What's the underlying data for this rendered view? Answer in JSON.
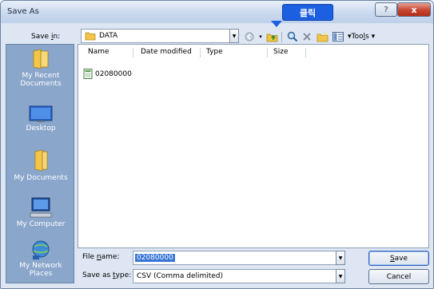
{
  "window": {
    "title": "Save As",
    "help_glyph": "?",
    "close_glyph": "x"
  },
  "callout": {
    "text": "클릭"
  },
  "toolbar": {
    "save_in_label_pre": "Save ",
    "save_in_label_key": "i",
    "save_in_label_post": "n:",
    "current_folder": "DATA",
    "tools_label_pre": "▾Too",
    "tools_label_key": "l",
    "tools_label_post": "s ▾"
  },
  "places": [
    {
      "label_line1": "My Recent",
      "label_line2": "Documents",
      "icon": "recent-docs-icon"
    },
    {
      "label_line1": "Desktop",
      "label_line2": "",
      "icon": "desktop-icon"
    },
    {
      "label_line1": "My Documents",
      "label_line2": "",
      "icon": "my-documents-icon"
    },
    {
      "label_line1": "My Computer",
      "label_line2": "",
      "icon": "my-computer-icon"
    },
    {
      "label_line1": "My Network",
      "label_line2": "Places",
      "icon": "network-places-icon"
    }
  ],
  "filelist": {
    "columns": [
      "Name",
      "Date modified",
      "Type",
      "Size"
    ],
    "files": [
      {
        "name": "02080000",
        "icon": "csv-file-icon"
      }
    ]
  },
  "form": {
    "file_name_label_pre": "File ",
    "file_name_label_key": "n",
    "file_name_label_post": "ame:",
    "file_name_value": "02080000",
    "save_type_label_pre": "Save as ",
    "save_type_label_key": "t",
    "save_type_label_post": "ype:",
    "save_type_value": "CSV (Comma delimited)"
  },
  "buttons": {
    "save_key": "S",
    "save_rest": "ave",
    "cancel": "Cancel"
  },
  "colors": {
    "accent": "#1c5fe0",
    "places_bg": "#8aa6cb",
    "dialog_bg": "#dde6f2",
    "selection": "#3875d7"
  }
}
